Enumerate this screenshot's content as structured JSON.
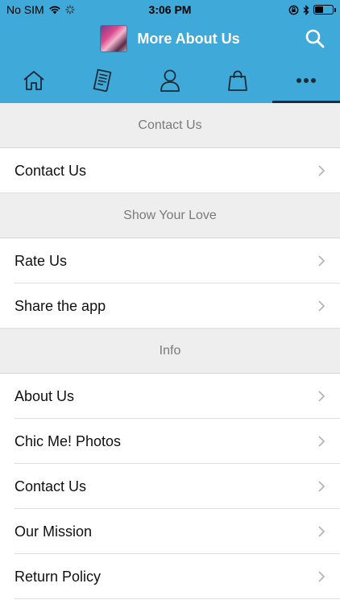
{
  "status_bar": {
    "carrier": "No SIM",
    "time": "3:06 PM",
    "battery_level": 0.45
  },
  "header": {
    "title": "More About Us",
    "search_icon": "search-icon",
    "logo": "app-logo"
  },
  "tabs": [
    {
      "name": "home",
      "icon": "home-icon",
      "active": false
    },
    {
      "name": "list",
      "icon": "document-list-icon",
      "active": false
    },
    {
      "name": "profile",
      "icon": "person-icon",
      "active": false
    },
    {
      "name": "shop",
      "icon": "shopping-bag-icon",
      "active": false
    },
    {
      "name": "more",
      "icon": "more-dots-icon",
      "active": true
    }
  ],
  "sections": [
    {
      "title": "Contact Us",
      "items": [
        "Contact Us"
      ]
    },
    {
      "title": "Show Your Love",
      "items": [
        "Rate Us",
        "Share the app"
      ]
    },
    {
      "title": "Info",
      "items": [
        "About Us",
        "Chic Me! Photos",
        "Contact Us",
        "Our Mission",
        "Return Policy"
      ]
    }
  ],
  "colors": {
    "primary": "#3fa9d9",
    "section_bg": "#eeeeee",
    "active_indicator": "#1d2b36"
  }
}
